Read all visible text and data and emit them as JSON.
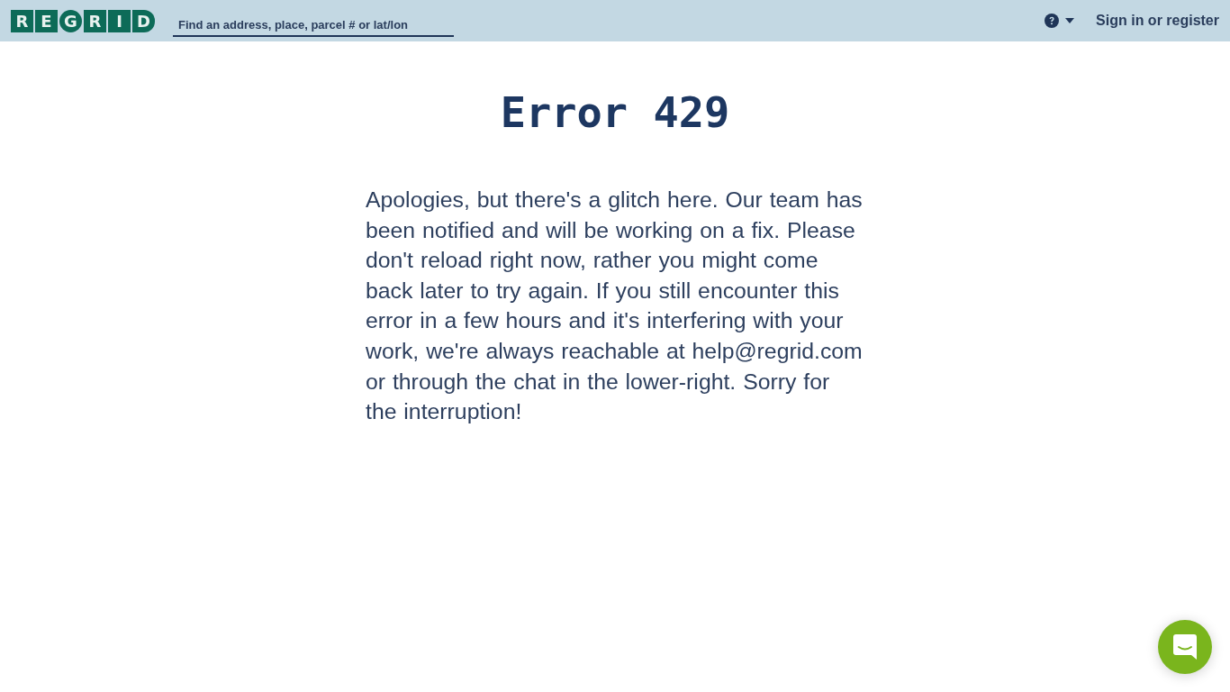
{
  "header": {
    "logo": {
      "letters": [
        "R",
        "E",
        "G",
        "R",
        "I",
        "D"
      ]
    },
    "search": {
      "placeholder": "Find an address, place, parcel # or lat/lon"
    },
    "sign_in_link": "Sign in or register"
  },
  "error": {
    "title": "Error 429",
    "message": "Apologies, but there's a glitch here. Our team has been notified and will be working on a fix. Please don't reload right now, rather you might come back later to try again. If you still encounter this error in a few hours and it's interfering with your work, we're always reachable at help@regrid.com or through the chat in the lower-right. Sorry for the interruption!"
  }
}
